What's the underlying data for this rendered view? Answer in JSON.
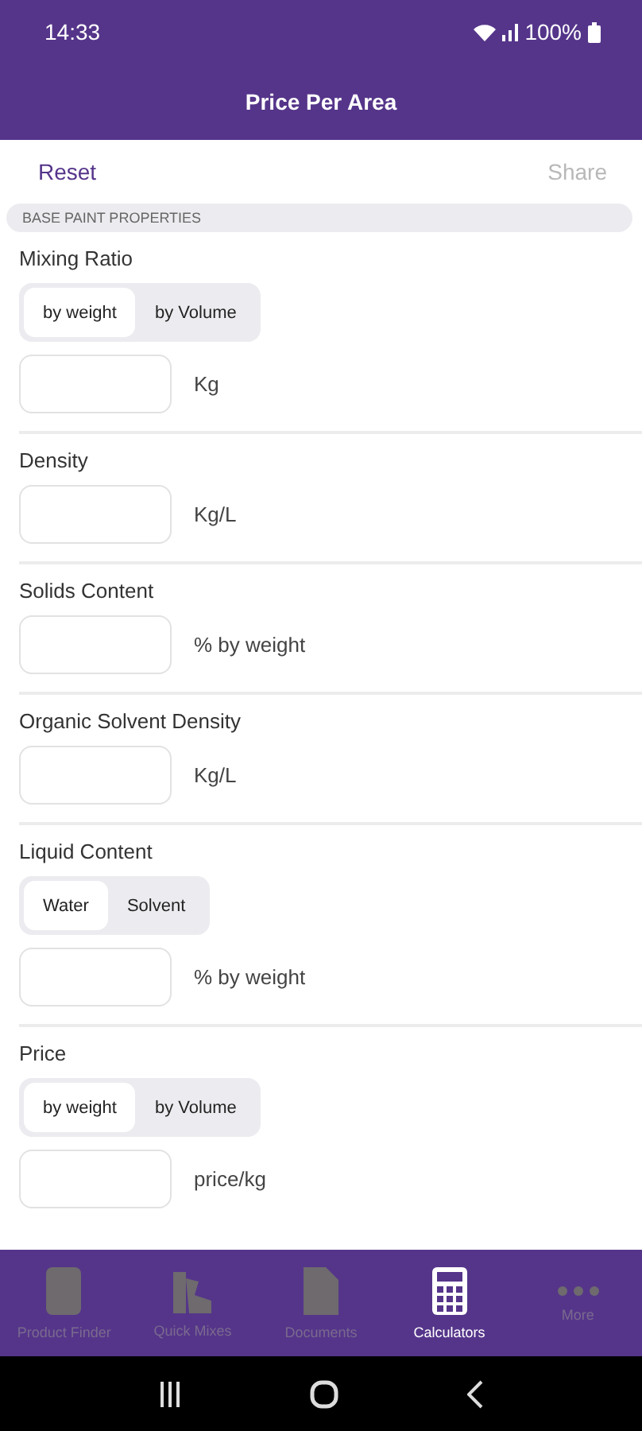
{
  "status_bar": {
    "time": "14:33",
    "battery": "100%"
  },
  "header": {
    "title": "Price Per Area"
  },
  "toolbar": {
    "reset": "Reset",
    "share": "Share",
    "share_disabled": true
  },
  "section": {
    "title": "BASE PAINT PROPERTIES"
  },
  "fields": [
    {
      "label": "Mixing Ratio",
      "options": [
        {
          "label": "by weight",
          "selected": true
        },
        {
          "label": "by Volume",
          "selected": false
        }
      ],
      "unit": "Kg"
    },
    {
      "label": "Density",
      "unit": "Kg/L"
    },
    {
      "label": "Solids Content",
      "unit": "% by weight"
    },
    {
      "label": "Organic Solvent Density",
      "unit": "Kg/L"
    },
    {
      "label": "Liquid Content",
      "options": [
        {
          "label": "Water",
          "selected": true
        },
        {
          "label": "Solvent",
          "selected": false
        }
      ],
      "unit": "% by weight"
    },
    {
      "label": "Price",
      "options": [
        {
          "label": "by weight",
          "selected": true
        },
        {
          "label": "by Volume",
          "selected": false
        }
      ],
      "unit": "price/kg"
    }
  ],
  "tabs": [
    {
      "label": "Product Finder",
      "kind": "can",
      "selected": false
    },
    {
      "label": "Quick Mixes",
      "kind": "fan",
      "selected": false
    },
    {
      "label": "Documents",
      "kind": "doc",
      "selected": false
    },
    {
      "label": "Calculators",
      "kind": "calc",
      "selected": true
    },
    {
      "label": "More",
      "kind": "dots",
      "selected": false
    }
  ]
}
